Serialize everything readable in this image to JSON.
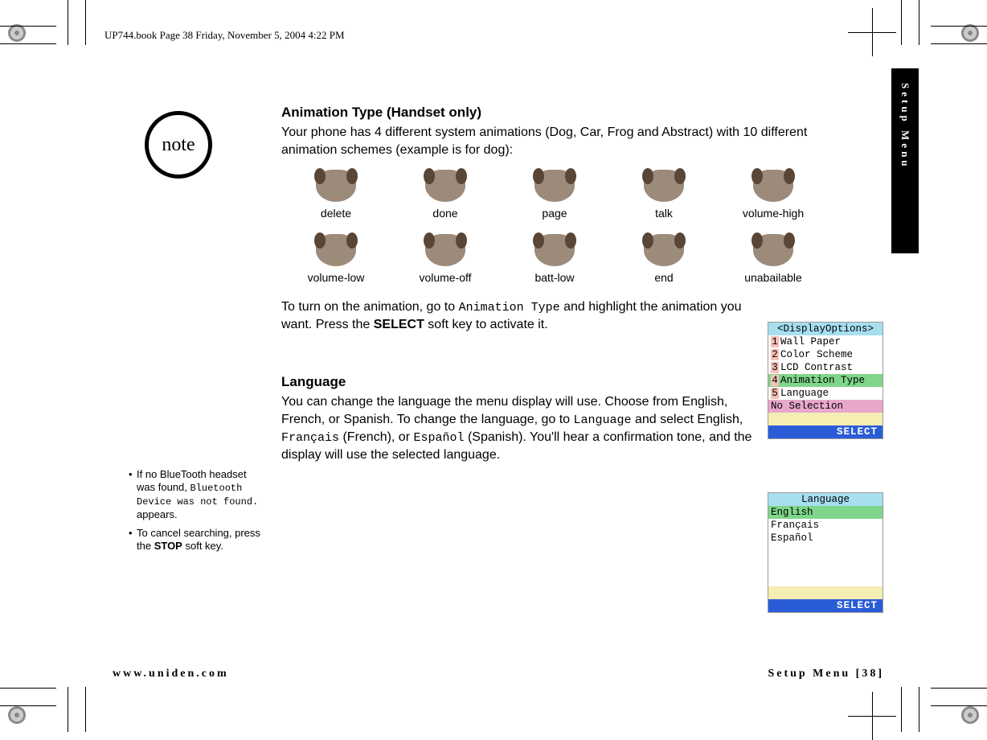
{
  "header": "UP744.book  Page 38  Friday, November 5, 2004  4:22 PM",
  "side_tab": "Setup Menu",
  "note_label": "note",
  "notes": {
    "n1_a": "If no BlueTooth headset was found, ",
    "n1_lcd": "Bluetooth Device was not found.",
    "n1_b": " appears.",
    "n2_a": "To cancel searching, press the ",
    "n2_bold": "STOP",
    "n2_b": " soft key."
  },
  "section1": {
    "heading": "Animation Type (Handset only)",
    "intro": "Your phone has 4 different system animations (Dog, Car, Frog and Abstract) with 10 different animation schemes (example is for dog):",
    "labels": [
      "delete",
      "done",
      "page",
      "talk",
      "volume-high",
      "volume-low",
      "volume-off",
      "batt-low",
      "end",
      "unabailable"
    ],
    "p2_a": "To turn on the animation, go to ",
    "p2_lcd1": "Animation Type",
    "p2_b": " and highlight the animation you want. Press the ",
    "p2_bold": "SELECT",
    "p2_c": " soft key to activate it."
  },
  "section2": {
    "heading": "Language",
    "p_a": "You can change the language the menu display will use. Choose from English, French, or Spanish. To change the language, go to ",
    "p_lcd1": "Language",
    "p_b": " and select English, ",
    "p_lcd2": "Français",
    "p_c": "  (French), or ",
    "p_lcd3": "Español",
    "p_d": " (Spanish). You'll hear a confirmation tone, and the display will use the selected language."
  },
  "lcd1": {
    "title": "<DisplayOptions>",
    "rows": [
      {
        "n": "1",
        "t": "Wall Paper"
      },
      {
        "n": "2",
        "t": "Color Scheme"
      },
      {
        "n": "3",
        "t": "LCD Contrast"
      },
      {
        "n": "4",
        "t": "Animation Type",
        "hl": true
      },
      {
        "n": "5",
        "t": "Language"
      }
    ],
    "status": "No Selection",
    "softkey": "SELECT"
  },
  "lcd2": {
    "title": "Language",
    "rows": [
      {
        "t": "English",
        "hl": true
      },
      {
        "t": "Français"
      },
      {
        "t": "Español"
      }
    ],
    "softkey": "SELECT"
  },
  "footer": {
    "left": "www.uniden.com",
    "right": "Setup Menu [38]"
  }
}
